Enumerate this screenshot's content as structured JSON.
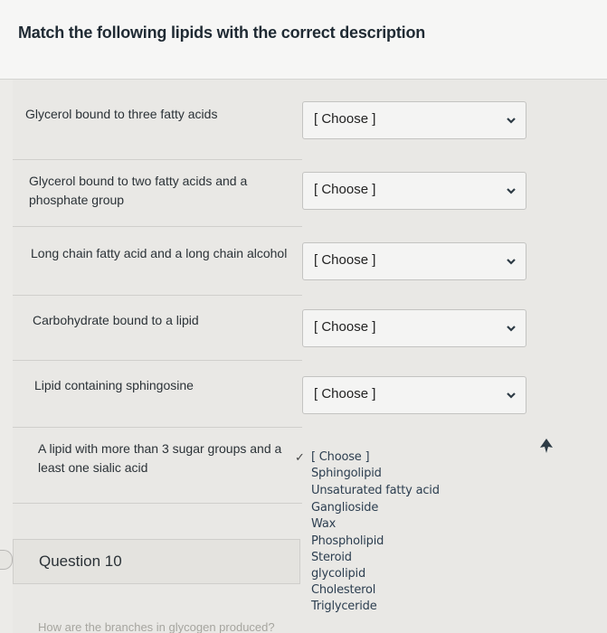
{
  "question": {
    "title": "Match the following lipids with the correct description"
  },
  "rows": [
    {
      "label": "Glycerol bound to three fatty acids",
      "selected": "[ Choose ]"
    },
    {
      "label": "Glycerol bound to two fatty acids and a phosphate group",
      "selected": "[ Choose ]"
    },
    {
      "label": "Long chain fatty acid and a long chain alcohol",
      "selected": "[ Choose ]"
    },
    {
      "label": "Carbohydrate bound to a lipid",
      "selected": "[ Choose ]"
    },
    {
      "label": "Lipid containing sphingosine",
      "selected": "[ Choose ]"
    },
    {
      "label": "A lipid with more than 3 sugar groups and a least one sialic acid",
      "selected": "[ Choose ]"
    }
  ],
  "dropdown": {
    "check": "✓",
    "options": [
      "[ Choose ]",
      "Sphingolipid",
      "Unsaturated fatty acid",
      "Ganglioside",
      "Wax",
      "Phospholipid",
      "Steroid",
      "glycolipid",
      "Cholesterol",
      "Triglyceride"
    ]
  },
  "next_question": {
    "label": "Question 10",
    "preview": "How are the branches in glycogen produced?"
  },
  "icons": {
    "chevron": "chevron-down-icon",
    "cursor": "mouse-cursor-icon"
  }
}
